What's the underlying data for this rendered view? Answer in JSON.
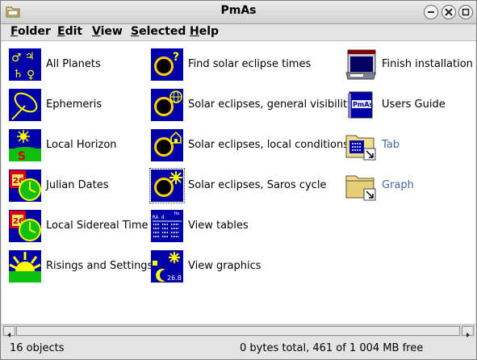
{
  "window": {
    "title": "PmAs"
  },
  "menu": [
    "Folder",
    "Edit",
    "View",
    "Selected",
    "Help"
  ],
  "objects": [
    {
      "label": "All Planets",
      "icon": "planet-symbols-icon"
    },
    {
      "label": "Ephemeris",
      "icon": "orbit-icon"
    },
    {
      "label": "Local Horizon",
      "icon": "horizon-icon"
    },
    {
      "label": "Julian Dates",
      "icon": "calendar-clock-icon"
    },
    {
      "label": "Local Sidereal Time",
      "icon": "calendar-clock-icon"
    },
    {
      "label": "Risings and Settings",
      "icon": "sunrise-icon"
    },
    {
      "label": "Find solar eclipse times",
      "icon": "eclipse-question-icon"
    },
    {
      "label": "Solar eclipses, general visibility",
      "icon": "eclipse-globe-icon"
    },
    {
      "label": "Solar eclipses, local conditions",
      "icon": "eclipse-house-icon"
    },
    {
      "label": "Solar eclipses, Saros cycle",
      "icon": "eclipse-star-icon"
    },
    {
      "label": "View tables",
      "icon": "table-icon"
    },
    {
      "label": "View graphics",
      "icon": "graphics-icon"
    },
    {
      "label": "Finish installation",
      "icon": "installer-window-icon"
    },
    {
      "label": "Users Guide",
      "icon": "book-icon"
    },
    {
      "label": "Tab",
      "icon": "folder-shadow-icon"
    },
    {
      "label": "Graph",
      "icon": "folder-shadow-icon"
    }
  ],
  "icon_text": {
    "calendar": "26",
    "pmas": "PmAs",
    "table_head": "RA  d",
    "table_corner": "Ha",
    "graphics_num": "26.8"
  },
  "status": {
    "count": "16 objects",
    "space": "0 bytes total, 461 of 1 004 MB free"
  },
  "colors": {
    "icon_blue": "#0000a8",
    "link_text": "#42689e",
    "sun_yellow": "#ffff00"
  }
}
